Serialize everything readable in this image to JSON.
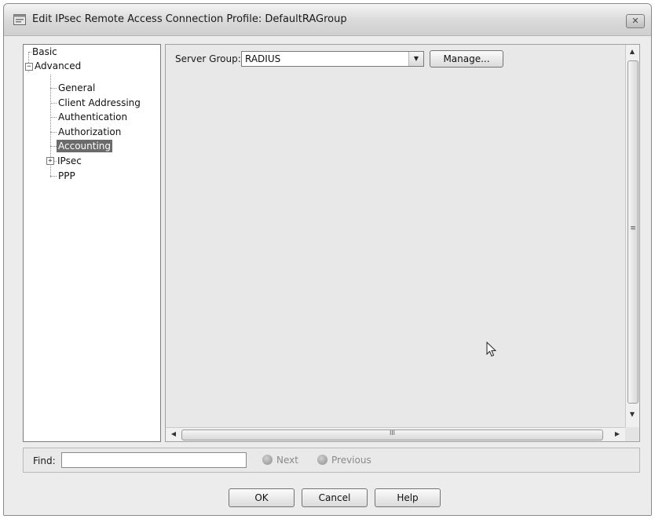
{
  "window": {
    "title": "Edit IPsec Remote Access Connection Profile: DefaultRAGroup",
    "close_label": "✕"
  },
  "tree": {
    "basic": "Basic",
    "advanced": "Advanced",
    "general": "General",
    "client_addressing": "Client Addressing",
    "authentication": "Authentication",
    "authorization": "Authorization",
    "accounting": "Accounting",
    "ipsec": "IPsec",
    "ppp": "PPP",
    "selected": "Accounting"
  },
  "panel": {
    "server_group_label": "Server Group:",
    "server_group_value": "RADIUS",
    "manage_label": "Manage...",
    "hscroll_grip": "III",
    "vscroll_grip": "≡"
  },
  "findbar": {
    "find_label": "Find:",
    "find_value": "",
    "next_label": "Next",
    "previous_label": "Previous"
  },
  "footer": {
    "ok_label": "OK",
    "cancel_label": "Cancel",
    "help_label": "Help"
  }
}
